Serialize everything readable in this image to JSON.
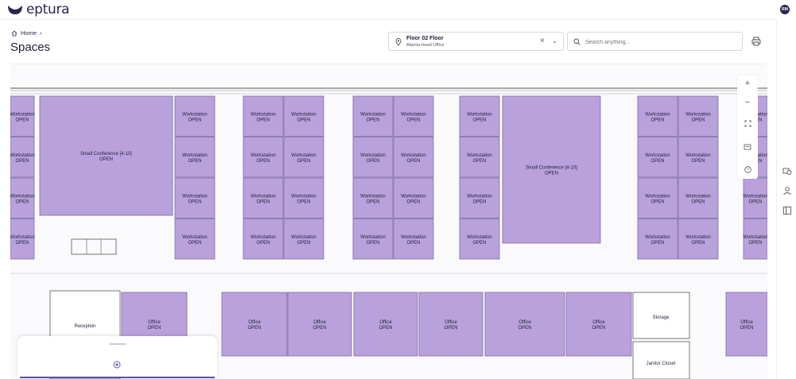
{
  "app": {
    "brand": "eptura",
    "user_initials": "RM"
  },
  "breadcrumb": {
    "home": "Home",
    "separator": "›"
  },
  "page": {
    "title": "Spaces"
  },
  "floor_selector": {
    "floor": "Floor 02 Floor",
    "building": "Atlanta Head Office"
  },
  "search": {
    "placeholder": "Search anything..."
  },
  "map": {
    "room_color": "#b9a2db",
    "rooms": [
      {
        "kind": "workstation",
        "name": "Workstation",
        "status": "OPEN"
      },
      {
        "kind": "conference",
        "name": "Small Conference [4-10]",
        "status": "OPEN"
      },
      {
        "kind": "office",
        "name": "Office",
        "status": "OPEN"
      },
      {
        "kind": "reception",
        "name": "Reception"
      },
      {
        "kind": "storage",
        "name": "Storage"
      },
      {
        "kind": "closet",
        "name": "Janitor Closet"
      }
    ]
  },
  "zoom": {
    "in": "+",
    "out": "−"
  },
  "colors": {
    "brand": "#2a2650",
    "room": "#b9a2db",
    "room_stroke": "#7f6aa8",
    "accent": "#5a4fa0"
  }
}
